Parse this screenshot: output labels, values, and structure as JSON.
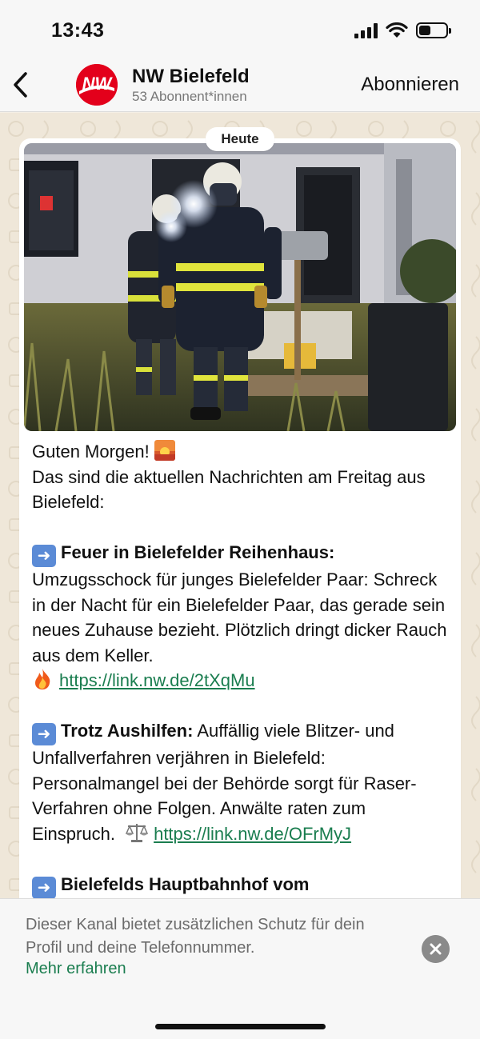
{
  "status_bar": {
    "time": "13:43",
    "icons": [
      "signal-icon",
      "wifi-icon",
      "battery-icon"
    ],
    "battery_level": 0.45
  },
  "header": {
    "back_icon": "chevron-left-icon",
    "logo_text": "NW",
    "channel_name": "NW Bielefeld",
    "subscribers": "53 Abonnent*innen",
    "subscribe_label": "Abonnieren"
  },
  "chat": {
    "date_chip": "Heute",
    "message": {
      "greeting": "Guten Morgen!",
      "intro": "Das sind die aktuellen Nachrichten am Freitag aus Bielefeld:",
      "items": [
        {
          "icon": "arrow-right-emoji",
          "headline": "Feuer in Bielefelder Reihenhaus:",
          "body": "Umzugsschock für junges Bielefelder Paar: Schreck in der Nacht für ein Bielefelder Paar, das gerade sein neues Zuhause bezieht. Plötzlich dringt dicker Rauch aus dem Keller.",
          "emoji": "fire-emoji",
          "link": "https://link.nw.de/2tXqMu"
        },
        {
          "icon": "arrow-right-emoji",
          "headline": "Trotz Aushilfen:",
          "body": "Auffällig viele Blitzer- und Unfallverfahren verjähren in Bielefeld: Personalmangel bei der Behörde sorgt für Raser-Verfahren ohne Folgen. Anwälte raten zum Einspruch.",
          "emoji": "scales-emoji",
          "link": "https://link.nw.de/OFrMyJ"
        },
        {
          "icon": "arrow-right-emoji",
          "headline": "Bielefelds Hauptbahnhof vom"
        }
      ]
    }
  },
  "notice": {
    "text": "Dieser Kanal bietet zusätzlichen Schutz für dein Profil und deine Telefonnummer.",
    "link": "Mehr erfahren",
    "close_icon": "close-icon"
  },
  "colors": {
    "accent_green": "#1a7d4f",
    "brand_red": "#e3001b",
    "chat_background": "#efe7d9"
  }
}
